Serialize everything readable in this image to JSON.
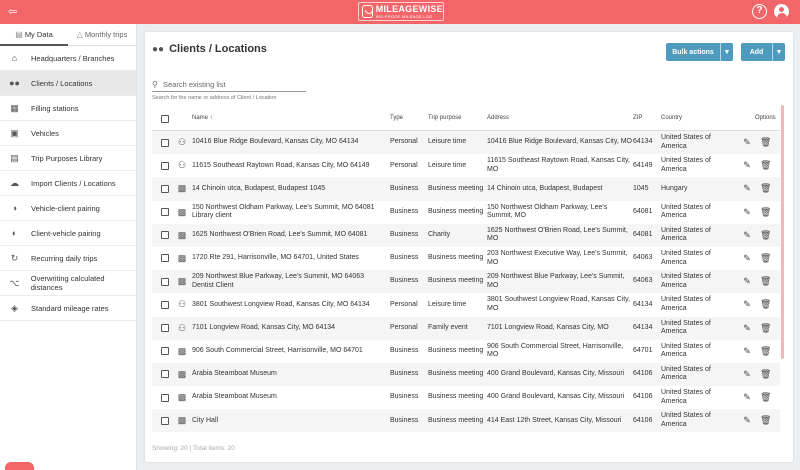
{
  "app": {
    "logo_title": "MILEAGEWISE",
    "logo_subtitle": "IRS-PROOF MILEAGE LOG"
  },
  "sidebar": {
    "tabs": [
      {
        "label": "My Data",
        "icon": "folder-icon",
        "active": true
      },
      {
        "label": "Monthly trips",
        "icon": "road-icon",
        "active": false
      }
    ],
    "items": [
      {
        "label": "Headquarters / Branches",
        "icon": "home-icon"
      },
      {
        "label": "Clients / Locations",
        "icon": "people-icon",
        "active": true
      },
      {
        "label": "Filling stations",
        "icon": "gas-station-icon"
      },
      {
        "label": "Vehicles",
        "icon": "car-icon"
      },
      {
        "label": "Trip Purposes Library",
        "icon": "library-icon"
      },
      {
        "label": "Import Clients / Locations",
        "icon": "cloud-upload-icon"
      },
      {
        "label": "Vehicle-client pairing",
        "icon": "toggle-icon"
      },
      {
        "label": "Client-vehicle pairing",
        "icon": "toggle-icon"
      },
      {
        "label": "Recurring daily trips",
        "icon": "repeat-icon"
      },
      {
        "label": "Overwriting calculated distances",
        "icon": "route-icon"
      },
      {
        "label": "Standard mileage rates",
        "icon": "tag-icon"
      }
    ]
  },
  "main": {
    "title": "Clients / Locations",
    "bulk_label": "Bulk actions",
    "add_label": "Add",
    "search_placeholder": "Search existing list",
    "search_hint": "Search for the name or address of Client / Location",
    "columns": {
      "name": "Name",
      "type": "Type",
      "purpose": "Trip purpose",
      "address": "Address",
      "zip": "ZIP",
      "country": "Country",
      "options": "Options"
    },
    "rows": [
      {
        "icon": "person-walking-icon",
        "name": "10416 Blue Ridge Boulevard, Kansas City, MO 64134",
        "type": "Personal",
        "purpose": "Leisure time",
        "address": "10416 Blue Ridge Boulevard, Kansas City, MO",
        "zip": "64134",
        "country": "United States of America"
      },
      {
        "icon": "person-walking-icon",
        "name": "11615 Southeast Raytown Road, Kansas City, MO 64149",
        "type": "Personal",
        "purpose": "Leisure time",
        "address": "11615 Southeast Raytown Road, Kansas City, MO",
        "zip": "64149",
        "country": "United States of America"
      },
      {
        "icon": "briefcase-icon",
        "name": "14 Chinoin utca, Budapest, Budapest 1045",
        "type": "Business",
        "purpose": "Business meeting",
        "address": "14 Chinoin utca, Budapest, Budapest",
        "zip": "1045",
        "country": "Hungary"
      },
      {
        "icon": "briefcase-icon",
        "name": "150 Northwest Oldham Parkway, Lee's Summit, MO 64081 Library client",
        "type": "Business",
        "purpose": "Business meeting",
        "address": "150 Northwest Oldham Parkway, Lee's Summit, MO",
        "zip": "64081",
        "country": "United States of America"
      },
      {
        "icon": "briefcase-icon",
        "name": "1625 Northwest O'Brien Road, Lee's Summit, MO 64081",
        "type": "Business",
        "purpose": "Charity",
        "address": "1625 Northwest O'Brien Road, Lee's Summit, MO",
        "zip": "64081",
        "country": "United States of America"
      },
      {
        "icon": "briefcase-icon",
        "name": "1720 Rte 291, Harrisonville, MO 64701, United States",
        "type": "Business",
        "purpose": "Business meeting",
        "address": "203 Northwest Executive Way, Lee's Summit, MO",
        "zip": "64063",
        "country": "United States of America"
      },
      {
        "icon": "briefcase-icon",
        "name": "209 Northwest Blue Parkway, Lee's Summit, MO 64063 Dentist Client",
        "type": "Business",
        "purpose": "Business meeting",
        "address": "209 Northwest Blue Parkway, Lee's Summit, MO",
        "zip": "64063",
        "country": "United States of America"
      },
      {
        "icon": "person-walking-icon",
        "name": "3801 Southwest Longview Road, Kansas City, MO 64134",
        "type": "Personal",
        "purpose": "Leisure time",
        "address": "3801 Southwest Longview Road, Kansas City, MO",
        "zip": "64134",
        "country": "United States of America"
      },
      {
        "icon": "person-walking-icon",
        "name": "7101 Longview Road, Kansas City, MO 64134",
        "type": "Personal",
        "purpose": "Family event",
        "address": "7101 Longview Road, Kansas City, MO",
        "zip": "64134",
        "country": "United States of America"
      },
      {
        "icon": "briefcase-icon",
        "name": "906 South Commercial Street, Harrisonville, MO 64701",
        "type": "Business",
        "purpose": "Business meeting",
        "address": "906 South Commercial Street, Harrisonville, MO",
        "zip": "64701",
        "country": "United States of America"
      },
      {
        "icon": "briefcase-icon",
        "name": "Arabia Steamboat Museum",
        "type": "Business",
        "purpose": "Business meeting",
        "address": "400 Grand Boulevard, Kansas City, Missouri",
        "zip": "64106",
        "country": "United States of America"
      },
      {
        "icon": "briefcase-icon",
        "name": "Arabia Steamboat Museum",
        "type": "Business",
        "purpose": "Business meeting",
        "address": "400 Grand Boulevard, Kansas City, Missouri",
        "zip": "64106",
        "country": "United States of America"
      },
      {
        "icon": "briefcase-icon",
        "name": "City Hall",
        "type": "Business",
        "purpose": "Business meeting",
        "address": "414 East 12th Street, Kansas City, Missouri",
        "zip": "64106",
        "country": "United States of America"
      }
    ],
    "footer": "Showing: 20 | Total items: 20"
  },
  "colors": {
    "brand": "#f2666a",
    "button": "#4d9cbf"
  }
}
